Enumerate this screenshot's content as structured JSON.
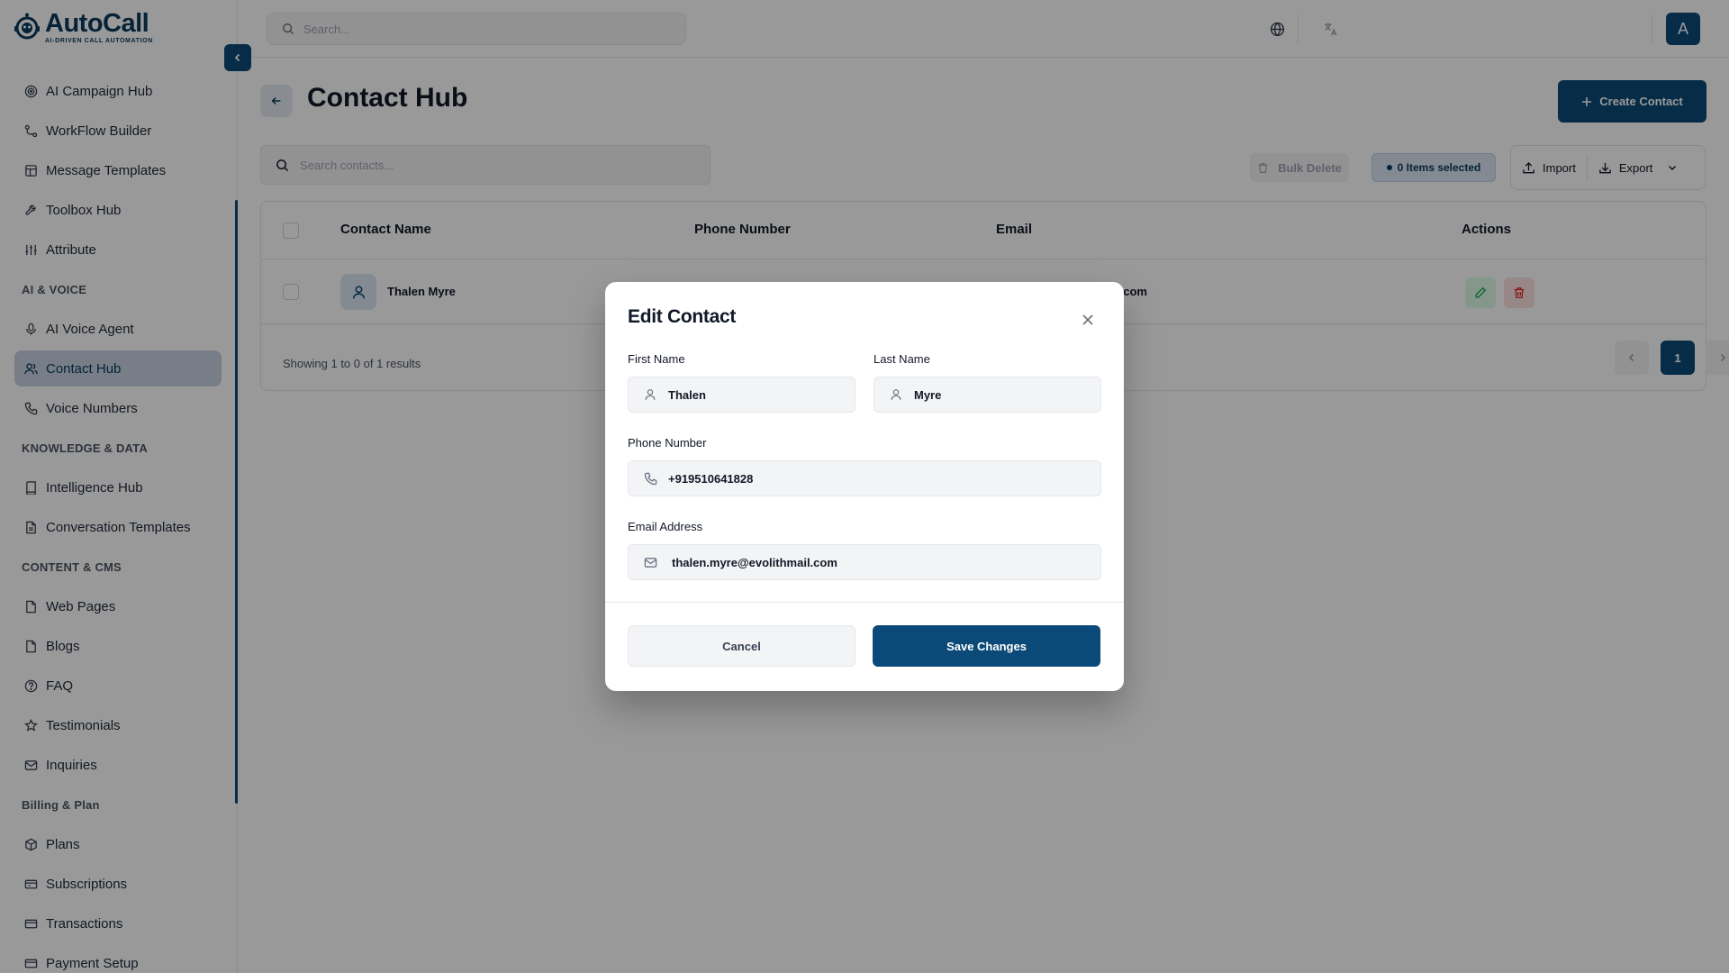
{
  "app": {
    "brand_title": "AutoCall",
    "brand_subtitle": "AI-DRIVEN CALL AUTOMATION",
    "accent_color": "#0b4a78"
  },
  "sidebar": {
    "items": [
      {
        "label": "AI Campaign Hub",
        "icon": "target-icon"
      },
      {
        "label": "WorkFlow Builder",
        "icon": "workflow-icon"
      },
      {
        "label": "Message Templates",
        "icon": "template-icon"
      },
      {
        "label": "Toolbox Hub",
        "icon": "wrench-icon"
      },
      {
        "label": "Attribute",
        "icon": "sliders-icon"
      }
    ],
    "section_ai_voice": "AI & VOICE",
    "ai_voice_items": [
      {
        "label": "AI Voice Agent",
        "icon": "mic-icon"
      },
      {
        "label": "Contact Hub",
        "icon": "users-icon",
        "active": true
      },
      {
        "label": "Voice Numbers",
        "icon": "phone-icon"
      }
    ],
    "section_knowledge": "KNOWLEDGE & DATA",
    "knowledge_items": [
      {
        "label": "Intelligence Hub",
        "icon": "book-icon"
      },
      {
        "label": "Conversation Templates",
        "icon": "file-icon"
      }
    ],
    "section_content": "CONTENT & CMS",
    "content_items": [
      {
        "label": "Web Pages",
        "icon": "page-icon"
      },
      {
        "label": "Blogs",
        "icon": "page-icon"
      },
      {
        "label": "FAQ",
        "icon": "help-circle-icon"
      },
      {
        "label": "Testimonials",
        "icon": "star-icon"
      },
      {
        "label": "Inquiries",
        "icon": "mail-icon"
      }
    ],
    "section_billing": "Billing & Plan",
    "billing_items": [
      {
        "label": "Plans",
        "icon": "package-icon"
      },
      {
        "label": "Subscriptions",
        "icon": "ticket-icon"
      },
      {
        "label": "Transactions",
        "icon": "card-icon"
      },
      {
        "label": "Payment Setup",
        "icon": "card-icon"
      }
    ]
  },
  "topbar": {
    "search_placeholder": "Search...",
    "avatar_initial": "A"
  },
  "main": {
    "page_title": "Contact Hub",
    "create_button": "Create Contact",
    "search_placeholder": "Search contacts...",
    "bulk_delete": "Bulk Delete",
    "items_selected": "0 Items selected",
    "import": "Import",
    "export": "Export",
    "table": {
      "headers": [
        "Contact Name",
        "Phone Number",
        "Email",
        "Actions"
      ],
      "rows": [
        {
          "name": "Thalen Myre",
          "email_visible_fragment": "l.com"
        }
      ]
    },
    "showing": "Showing 1 to 0 of 1 results",
    "current_page": "1"
  },
  "modal": {
    "title": "Edit Contact",
    "first_name_label": "First Name",
    "first_name_value": "Thalen",
    "last_name_label": "Last Name",
    "last_name_value": "Myre",
    "phone_label": "Phone Number",
    "phone_value": "+919510641828",
    "email_label": "Email Address",
    "email_value": "thalen.myre@evolithmail.com",
    "cancel": "Cancel",
    "save": "Save Changes"
  }
}
